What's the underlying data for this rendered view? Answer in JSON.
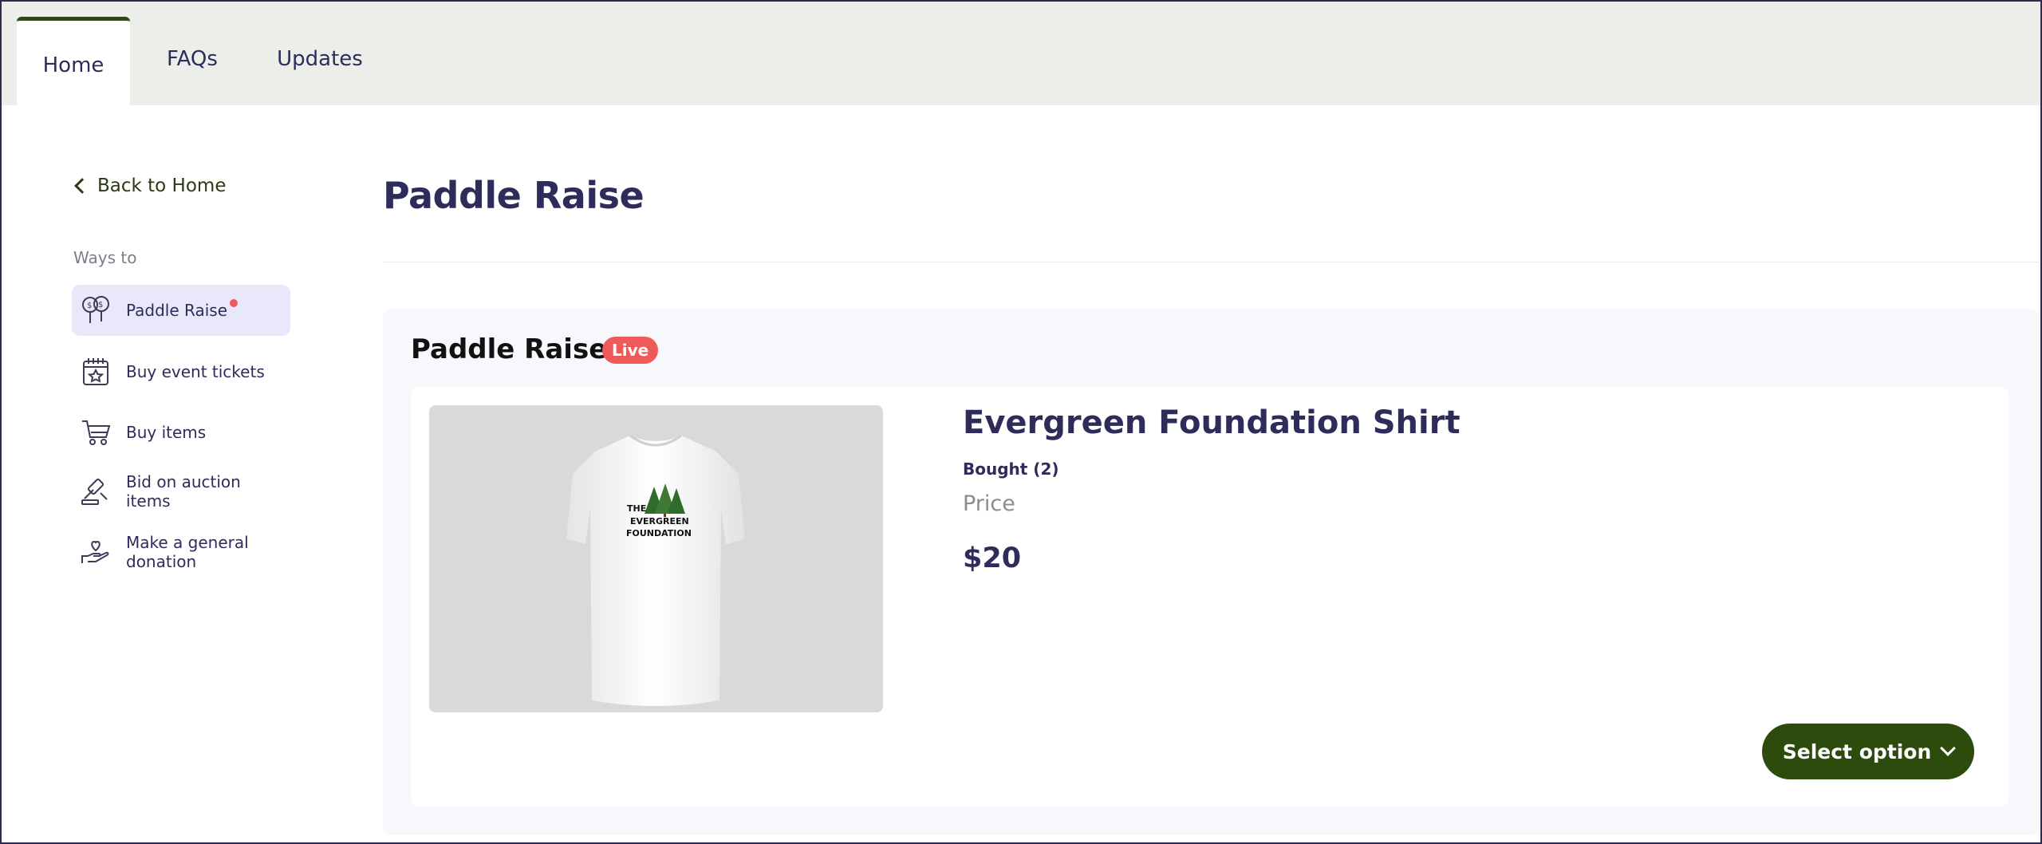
{
  "tabs": [
    {
      "label": "Home",
      "active": true
    },
    {
      "label": "FAQs"
    },
    {
      "label": "Updates"
    }
  ],
  "sidebar": {
    "back_label": "Back to Home",
    "section_label": "Ways to",
    "items": [
      {
        "label": "Paddle Raise",
        "icon": "paddle-icon",
        "active": true,
        "has_dot": true
      },
      {
        "label": "Buy event tickets",
        "icon": "calendar-star-icon"
      },
      {
        "label": "Buy items",
        "icon": "cart-icon"
      },
      {
        "label": "Bid on auction items",
        "icon": "gavel-icon"
      },
      {
        "label": "Make a general donation",
        "icon": "hand-heart-icon"
      }
    ]
  },
  "main": {
    "title": "Paddle Raise",
    "panel": {
      "title": "Paddle Raise",
      "status_badge": "Live",
      "product": {
        "name": "Evergreen Foundation Shirt",
        "bought": "Bought (2)",
        "price_label": "Price",
        "price": "$20",
        "image_text": [
          "THE",
          "EVERGREEN",
          "FOUNDATION"
        ],
        "button_label": "Select option"
      }
    }
  },
  "colors": {
    "accent_green": "#2c4b0d",
    "live_red": "#ee5a5a",
    "navy_text": "#2e2c5a",
    "active_nav_bg": "#e9e8fb"
  }
}
